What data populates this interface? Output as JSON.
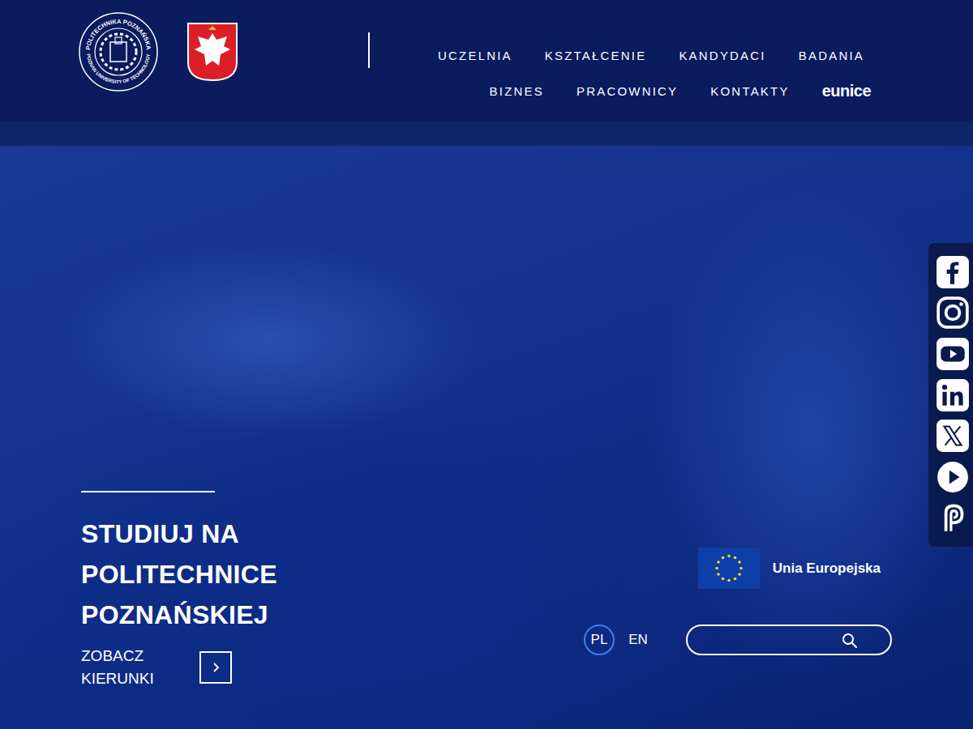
{
  "logo": {
    "seal_top": "POLITECHNIKA POZNAŃSKA",
    "seal_bottom": "POZNAN UNIVERSITY OF TECHNOLOGY"
  },
  "nav": {
    "rows": [
      [
        {
          "label": "UCZELNIA",
          "kind": "link"
        },
        {
          "label": "KSZTAŁCENIE",
          "kind": "link"
        },
        {
          "label": "KANDYDACI",
          "kind": "link"
        },
        {
          "label": "BADANIA",
          "kind": "link"
        }
      ],
      [
        {
          "label": "BIZNES",
          "kind": "link"
        },
        {
          "label": "PRACOWNICY",
          "kind": "link"
        },
        {
          "label": "KONTAKTY",
          "kind": "link"
        },
        {
          "label": "eunice",
          "kind": "logo"
        }
      ]
    ]
  },
  "hero": {
    "title": "STUDIUJ NA POLITECHNICE POZNAŃSKIEJ",
    "cta": "ZOBACZ KIERUNKI"
  },
  "eu": {
    "label": "Unia Europejska"
  },
  "languages": [
    {
      "label": "PL",
      "selected": true
    },
    {
      "label": "EN",
      "selected": false
    }
  ],
  "search": {
    "placeholder": "",
    "value": ""
  }
}
